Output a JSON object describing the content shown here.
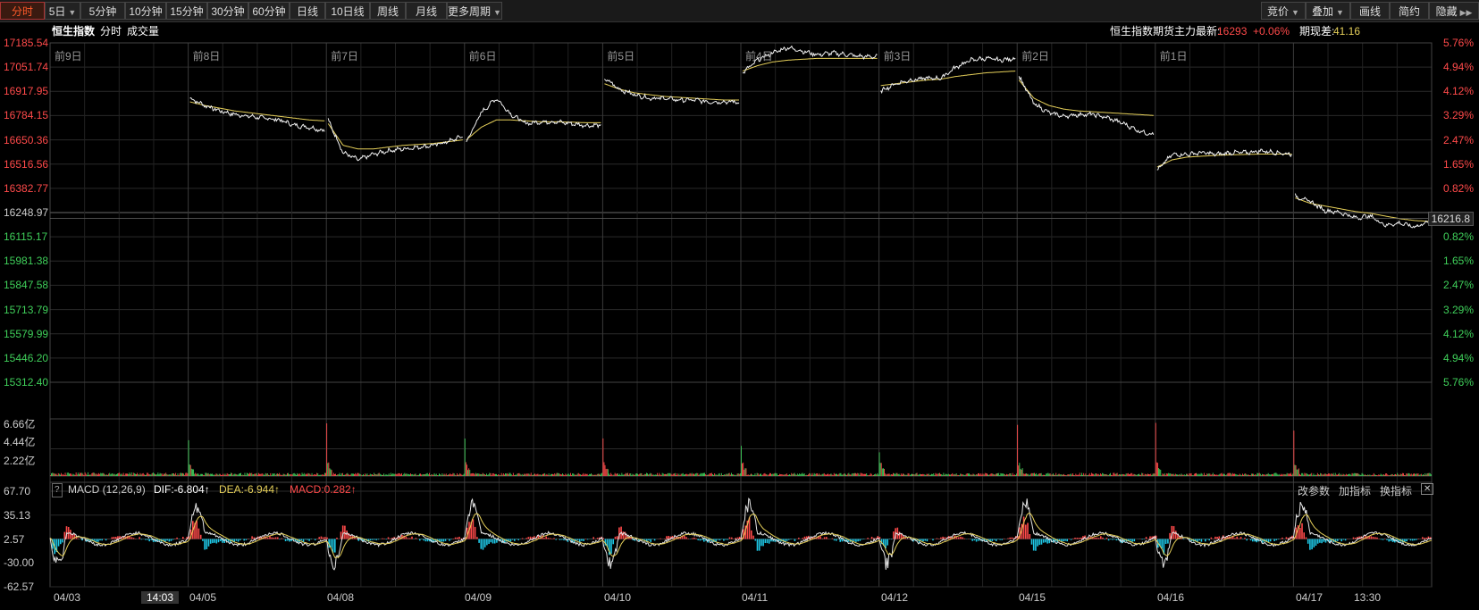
{
  "toolbar": {
    "left_tabs": [
      "分时",
      "5日",
      "5分钟",
      "10分钟",
      "15分钟",
      "30分钟",
      "60分钟",
      "日线",
      "10日线",
      "周线",
      "月线",
      "更多周期"
    ],
    "right_tabs": [
      "竞价",
      "叠加",
      "画线",
      "简约",
      "隐藏"
    ]
  },
  "infobar": {
    "name": "恒生指数",
    "mode": "分时",
    "volume_label": "成交量",
    "futures_label": "恒生指数期货主力最新:",
    "futures_price": "16293",
    "futures_change": "+0.06%",
    "basis_label": "期现差:",
    "basis_value": "41.16"
  },
  "price_axis": {
    "left_up": [
      "17185.54",
      "17051.74",
      "16917.95",
      "16784.15",
      "16650.36",
      "16516.56",
      "16382.77"
    ],
    "left_mid": "16248.97",
    "left_down": [
      "16115.17",
      "15981.38",
      "15847.58",
      "15713.79",
      "15579.99",
      "15446.20",
      "15312.40"
    ],
    "right_up": [
      "5.76%",
      "4.94%",
      "4.12%",
      "3.29%",
      "2.47%",
      "1.65%",
      "0.82%"
    ],
    "right_down": [
      "0.82%",
      "1.65%",
      "2.47%",
      "3.29%",
      "4.12%",
      "4.94%",
      "5.76%"
    ],
    "current_price_tag": "16216.8"
  },
  "day_labels": [
    "前9日",
    "前8日",
    "前7日",
    "前6日",
    "前5日",
    "前4日",
    "前3日",
    "前2日",
    "前1日"
  ],
  "volume_axis": [
    "6.66亿",
    "4.44亿",
    "2.22亿"
  ],
  "macd": {
    "title": "MACD (12,26,9)",
    "dif": "DIF:-6.804↑",
    "dea": "DEA:-6.944↑",
    "macd": "MACD:0.282↑",
    "buttons": [
      "改参数",
      "加指标",
      "换指标"
    ],
    "axis": [
      "67.70",
      "35.13",
      "2.57",
      "-30.00",
      "-62.57"
    ]
  },
  "x_axis": [
    "04/03",
    "04/05",
    "04/08",
    "04/09",
    "04/10",
    "04/11",
    "04/12",
    "04/15",
    "04/16",
    "04/17",
    "13:30"
  ],
  "cursor_time": "14:03",
  "chart_data": {
    "type": "line",
    "title": "恒生指数",
    "ylabel": "",
    "ylim": [
      15312.4,
      17185.54
    ],
    "base": 16248.97,
    "series": [
      {
        "name": "前9日",
        "price": [
          16880,
          16840,
          16810,
          16790,
          16780,
          16770,
          16760,
          16730,
          16720,
          16700
        ],
        "avg": [
          16860,
          16840,
          16825,
          16810,
          16800,
          16790,
          16780,
          16770,
          16760,
          16755
        ]
      },
      {
        "name": "前8日",
        "price": [
          16760,
          16580,
          16540,
          16570,
          16590,
          16600,
          16610,
          16620,
          16640,
          16670
        ],
        "avg": [
          16740,
          16620,
          16600,
          16600,
          16610,
          16620,
          16625,
          16630,
          16640,
          16650
        ]
      },
      {
        "name": "前7日",
        "price": [
          16640,
          16800,
          16880,
          16790,
          16740,
          16750,
          16750,
          16740,
          16730,
          16730
        ],
        "avg": [
          16650,
          16720,
          16760,
          16760,
          16755,
          16750,
          16750,
          16748,
          16745,
          16745
        ]
      },
      {
        "name": "前6日",
        "price": [
          16990,
          16930,
          16900,
          16880,
          16880,
          16870,
          16870,
          16860,
          16860,
          16860
        ],
        "avg": [
          16960,
          16930,
          16910,
          16900,
          16890,
          16885,
          16880,
          16875,
          16870,
          16870
        ]
      },
      {
        "name": "前5日",
        "price": [
          17020,
          17090,
          17130,
          17160,
          17140,
          17120,
          17130,
          17120,
          17110,
          17110
        ],
        "avg": [
          17030,
          17060,
          17080,
          17090,
          17095,
          17100,
          17100,
          17100,
          17100,
          17100
        ]
      },
      {
        "name": "前4日",
        "price": [
          16920,
          16960,
          16980,
          16990,
          16990,
          17050,
          17090,
          17100,
          17090,
          17100
        ],
        "avg": [
          16950,
          16960,
          16970,
          16980,
          16985,
          17000,
          17010,
          17020,
          17025,
          17030
        ]
      },
      {
        "name": "前3日",
        "price": [
          17000,
          16850,
          16800,
          16780,
          16790,
          16790,
          16770,
          16740,
          16700,
          16680
        ],
        "avg": [
          16980,
          16880,
          16840,
          16820,
          16810,
          16805,
          16800,
          16795,
          16790,
          16785
        ]
      },
      {
        "name": "前2日",
        "price": [
          16480,
          16570,
          16570,
          16580,
          16570,
          16580,
          16580,
          16590,
          16580,
          16570
        ],
        "avg": [
          16500,
          16540,
          16555,
          16560,
          16565,
          16568,
          16570,
          16572,
          16572,
          16572
        ]
      },
      {
        "name": "前1日",
        "price": [
          16340,
          16310,
          16260,
          16250,
          16220,
          16230,
          16180,
          16190,
          16170,
          16200
        ],
        "avg": [
          16330,
          16300,
          16285,
          16270,
          16255,
          16245,
          16230,
          16215,
          16205,
          16200
        ]
      }
    ]
  }
}
